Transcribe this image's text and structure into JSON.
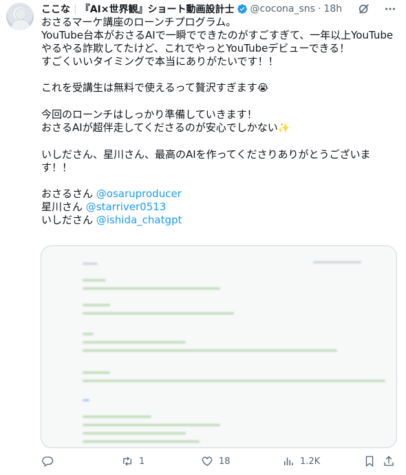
{
  "author": {
    "display_name": "ここな",
    "title_tag": "『AI×世界観』ショート動画設計士",
    "handle": "@cocona_sns",
    "time": "18h"
  },
  "tweet": {
    "lines": [
      "おさるマーケ講座のローンチプログラム。",
      "YouTube台本がおさるAIで一瞬でできたのがすごすぎて、一年以上YouTube",
      "やるやる詐欺してたけど、これでやっとYouTubeデビューできる！",
      "すごくいいタイミングで本当にありがたいです！！",
      "これを受講生は無料で使えるって贅沢すぎます",
      "今回のローンチはしっかり準備していきます！",
      "おさるAIが超伴走してくださるのが安心でしかない",
      "いしださん、星川さん、最高のAIを作ってくださりありがとうございま",
      "す！！"
    ],
    "emoji_1": "😭",
    "emoji_2": "✨",
    "mentions": [
      {
        "prefix": "おさるさん ",
        "handle": "@osaruproducer"
      },
      {
        "prefix": "星川さん ",
        "handle": "@starriver0513"
      },
      {
        "prefix": "いしださん ",
        "handle": "@ishida_chatgpt"
      }
    ]
  },
  "actions": {
    "reply": {
      "icon": "reply-icon",
      "count": ""
    },
    "retweet": {
      "icon": "retweet-icon",
      "count": "1"
    },
    "like": {
      "icon": "heart-icon",
      "count": "18"
    },
    "views": {
      "icon": "views-icon",
      "count": "1.2K"
    }
  },
  "colors": {
    "text": "#0f1419",
    "secondary": "#536471",
    "link": "#1d9bf0",
    "verified": "#1d9bf0"
  }
}
